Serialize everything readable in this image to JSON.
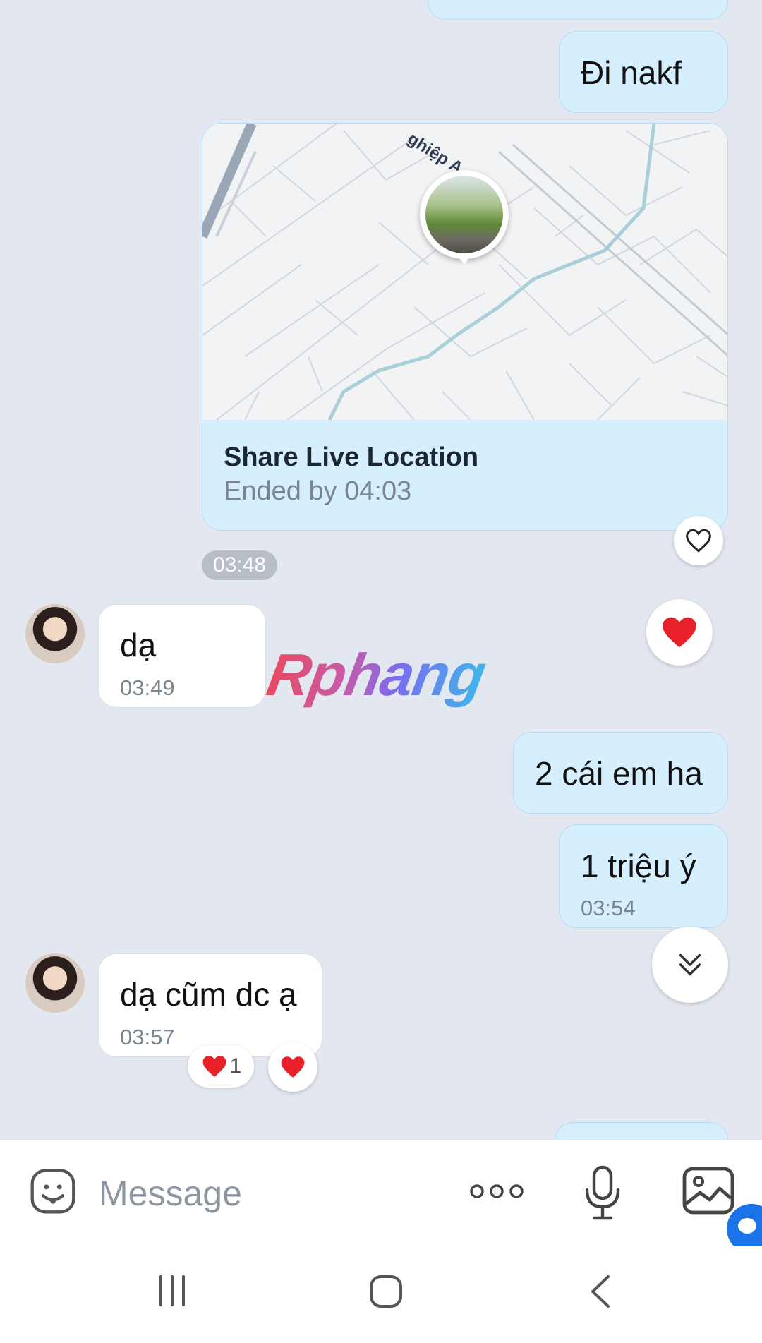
{
  "messages": {
    "m1_text": "Đi nakf",
    "location": {
      "title": "Share Live Location",
      "subtitle": "Ended by 04:03",
      "map_street_label": "ghiệp A",
      "time_pill": "03:48"
    },
    "m3": {
      "text": "dạ",
      "time": "03:49"
    },
    "m4_text": "2 cái em ha",
    "m5": {
      "text": "1 triệu ý",
      "time": "03:54"
    },
    "m6": {
      "text": "dạ cũm dc ạ",
      "time": "03:57",
      "reaction_count": "1"
    }
  },
  "watermark": "Rphang",
  "composer": {
    "placeholder": "Message"
  },
  "icons": {
    "heart_outline": "heart-outline-icon",
    "heart_filled": "heart-filled-icon",
    "scroll_down": "double-chevron-down-icon",
    "emoji": "emoji-icon",
    "more": "more-dots-icon",
    "mic": "microphone-icon",
    "gallery": "image-icon"
  },
  "colors": {
    "background": "#e3e8f0",
    "bubble_out": "#d6efff",
    "bubble_in": "#ffffff",
    "heart": "#e8202a",
    "accent": "#1a73e8"
  }
}
